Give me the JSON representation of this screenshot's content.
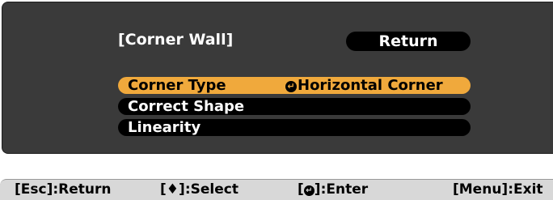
{
  "panel": {
    "title": "[Corner Wall]",
    "return_label": "Return"
  },
  "menu": {
    "items": [
      {
        "label": "Corner Type",
        "value_icon": "enter-icon",
        "value": "Horizontal Corner",
        "selected": true
      },
      {
        "label": "Correct Shape",
        "value": "",
        "selected": false
      },
      {
        "label": "Linearity",
        "value": "",
        "selected": false
      }
    ]
  },
  "footer": {
    "esc": {
      "key": "[Esc]",
      "action": ":Return"
    },
    "select": {
      "bracket_open": "[",
      "icon": "up-down-arrows-icon",
      "bracket_close": "]",
      "action": ":Select"
    },
    "enter": {
      "bracket_open": "[",
      "icon": "enter-icon",
      "bracket_close": "]",
      "action": ":Enter"
    },
    "menu": {
      "key": "[Menu]",
      "action": ":Exit"
    }
  },
  "colors": {
    "panel_bg": "#3a3a3a",
    "row_bg": "#000000",
    "selected_bg": "#f0a93c",
    "footer_bg": "#d8d8d8"
  }
}
